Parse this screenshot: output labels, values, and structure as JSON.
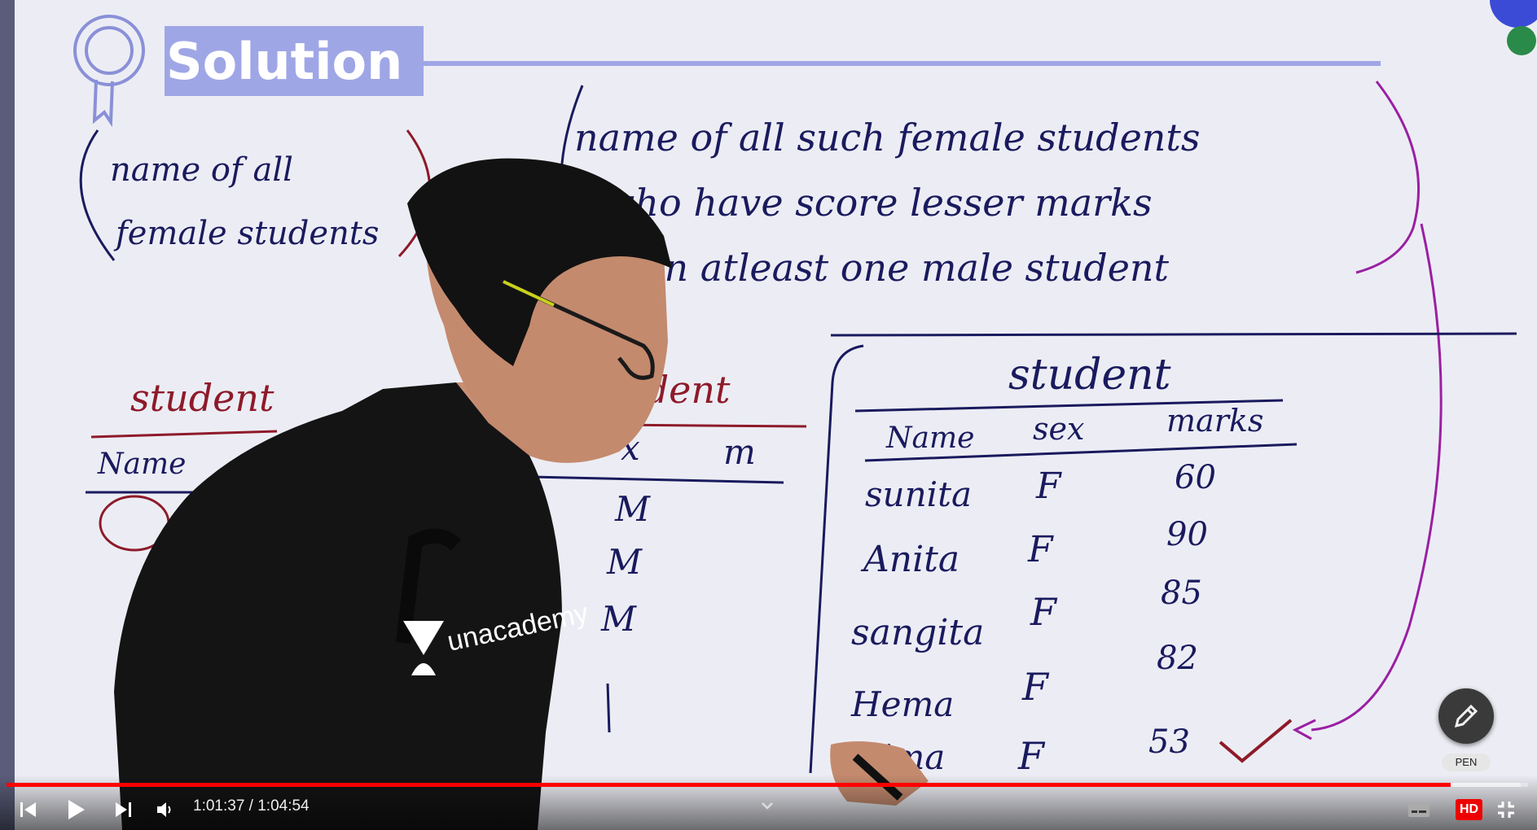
{
  "board": {
    "heading": "Solution",
    "left_bracket_text": [
      "name of all",
      "female students"
    ],
    "right_bracket_text": [
      "name of all such female students",
      "who have score lesser marks",
      "than atleast one male student"
    ],
    "left_table_title": "student",
    "left_table_headers": [
      "Name"
    ],
    "middle_table_title": "student",
    "middle_table_headers": [
      "x",
      "m"
    ],
    "middle_table_sex": [
      "M",
      "M",
      "M"
    ],
    "right_table": {
      "title": "student",
      "headers": [
        "Name",
        "sex",
        "marks"
      ],
      "rows": [
        {
          "name": "sunita",
          "sex": "F",
          "marks": "60"
        },
        {
          "name": "Anita",
          "sex": "F",
          "marks": "90"
        },
        {
          "name": "sangita",
          "sex": "F",
          "marks": "85"
        },
        {
          "name": "Hema",
          "sex": "F",
          "marks": "82"
        },
        {
          "name": "nima",
          "sex": "F",
          "marks": "53"
        }
      ]
    },
    "shirt_brand": "unacademy"
  },
  "player": {
    "current_time": "1:01:37",
    "duration": "1:04:54",
    "time_display": "1:01:37 / 1:04:54",
    "progress": 0.949,
    "loaded": 0.995,
    "hd_label": "HD",
    "pen_label": "PEN",
    "icons": [
      "skip-previous-icon",
      "play-icon",
      "skip-next-icon",
      "volume-icon",
      "chevron-down-icon",
      "subtitles-icon",
      "settings-hd-icon",
      "exit-fullscreen-icon",
      "pen-icon"
    ]
  },
  "colors": {
    "board": "#ecedf4",
    "ink_navy": "#1a1a5e",
    "ink_red": "#8e1a2a",
    "ink_purple": "#9a1fa3",
    "title_bar": "#9fa6e6",
    "progress": "#ff0000"
  }
}
